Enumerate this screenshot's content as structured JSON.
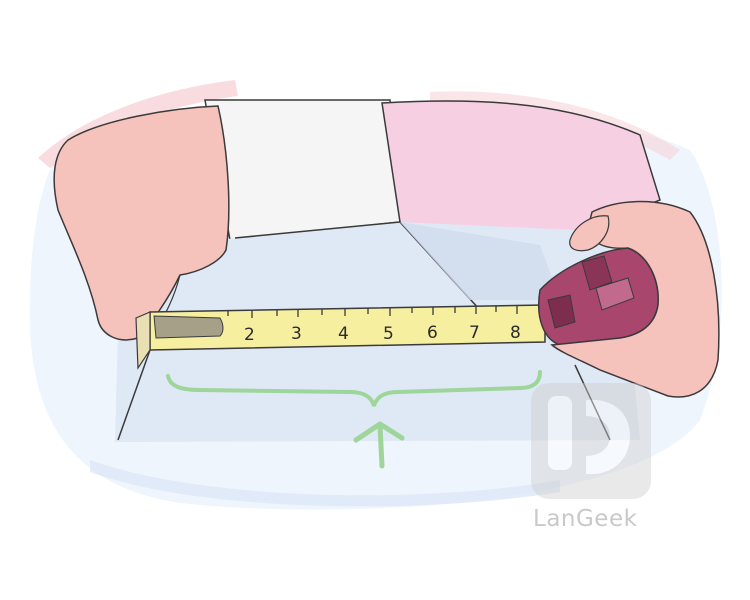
{
  "tape": {
    "ticks": [
      "2",
      "3",
      "4",
      "5",
      "6",
      "7",
      "8"
    ],
    "blade_color": "#f6ef9f",
    "case_color": "#a8466e"
  },
  "watermark": {
    "brand_text": "LanGeek",
    "logo_name": "langeek-logo-icon"
  }
}
